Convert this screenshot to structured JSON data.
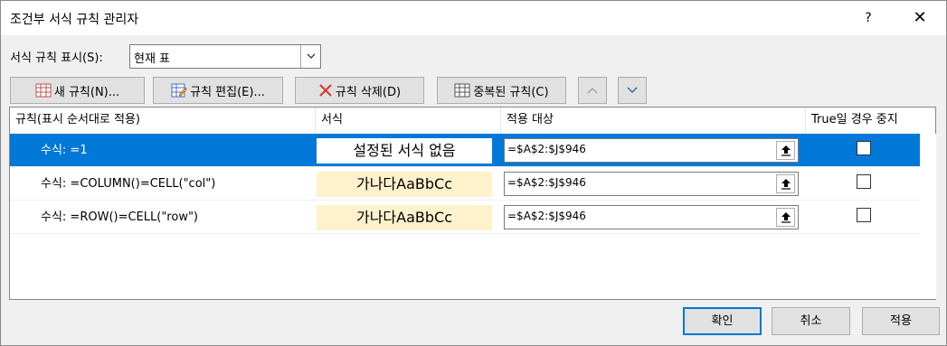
{
  "window": {
    "title": "조건부 서식 규칙 관리자",
    "help_label": "?",
    "close_label": "✕"
  },
  "show_rules": {
    "label": "서식 규칙 표시(S):",
    "selected": "현재 표"
  },
  "toolbar": {
    "new_rule": "새 규칙(N)...",
    "edit_rule": "규칙 편집(E)...",
    "delete_rule": "규칙 삭제(D)",
    "duplicate_rule": "중복된 규칙(C)",
    "move_up": "^",
    "move_down": "v"
  },
  "columns": {
    "rule": "규칙(표시 순서대로 적용)",
    "format": "서식",
    "applies_to": "적용 대상",
    "stop_if_true": "True일 경우 중지"
  },
  "rules": [
    {
      "label": "수식: =1",
      "preview": "설정된 서식 없음",
      "applies_to": "=$A$2:$J$946",
      "stop_if_true": false,
      "selected": true
    },
    {
      "label": "수식: =COLUMN()=CELL(\"col\")",
      "preview": "가나다AaBbCc",
      "applies_to": "=$A$2:$J$946",
      "stop_if_true": false,
      "selected": false
    },
    {
      "label": "수식: =ROW()=CELL(\"row\")",
      "preview": "가나다AaBbCc",
      "applies_to": "=$A$2:$J$946",
      "stop_if_true": false,
      "selected": false
    }
  ],
  "footer": {
    "ok": "확인",
    "cancel": "취소",
    "apply": "적용"
  },
  "colors": {
    "selection": "#0078d7",
    "preview_fill": "#fff2cc"
  }
}
